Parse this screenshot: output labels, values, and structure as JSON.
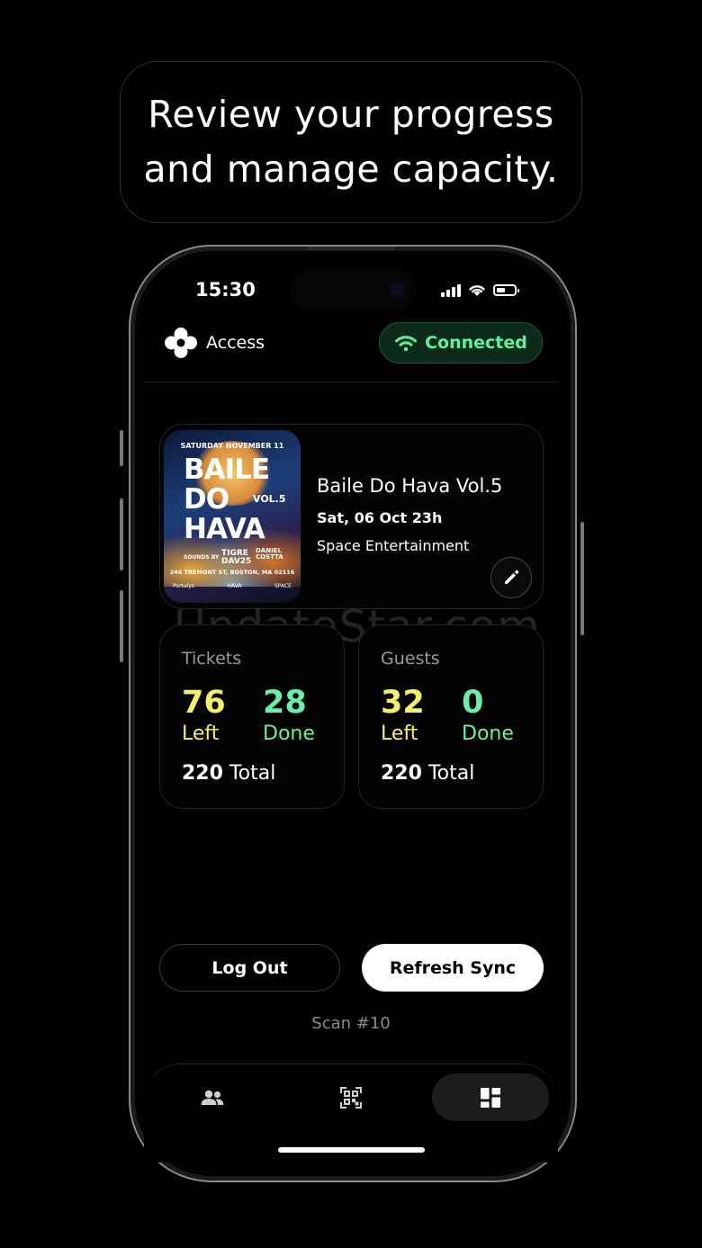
{
  "headline": {
    "line1": "Review your progress",
    "line2": "and manage capacity."
  },
  "status_bar": {
    "time": "15:30"
  },
  "header": {
    "brand_label": "Access",
    "connection_label": "Connected",
    "connection_color": "#5ff0a0"
  },
  "event": {
    "title": "Baile Do Hava Vol.5",
    "date": "Sat, 06 Oct 23h",
    "organizer": "Space Entertainment",
    "poster": {
      "date": "SATURDAY NOVEMBER 11",
      "title_line1": "BAILE",
      "title_line2": "DO",
      "title_line3": "HAVA",
      "volume": "VOL.5",
      "sounds_by": "SOUNDS BY",
      "dj1_line1": "TIGRE",
      "dj1_line2": "DAV25",
      "dj2_line1": "DANIEL",
      "dj2_line2": "COSTTA",
      "address": "246 TREMONT ST, BOSTON, MA 02116",
      "logos": [
        "Portalys",
        "HAVA",
        "SPACE"
      ]
    }
  },
  "stats": {
    "tickets": {
      "label": "Tickets",
      "left_value": "76",
      "left_label": "Left",
      "done_value": "28",
      "done_label": "Done",
      "total_value": "220",
      "total_label": "Total"
    },
    "guests": {
      "label": "Guests",
      "left_value": "32",
      "left_label": "Left",
      "done_value": "0",
      "done_label": "Done",
      "total_value": "220",
      "total_label": "Total"
    }
  },
  "watermark": "UpdateStar.com",
  "actions": {
    "logout_label": "Log Out",
    "refresh_label": "Refresh Sync"
  },
  "scan_label": "Scan #10",
  "tabs": [
    {
      "icon": "people-icon",
      "active": false
    },
    {
      "icon": "qr-scan-icon",
      "active": false
    },
    {
      "icon": "dashboard-icon",
      "active": true
    }
  ],
  "colors": {
    "left": "#f6f06a",
    "done": "#6af0a6",
    "connected_bg": "#0c2a1a"
  }
}
